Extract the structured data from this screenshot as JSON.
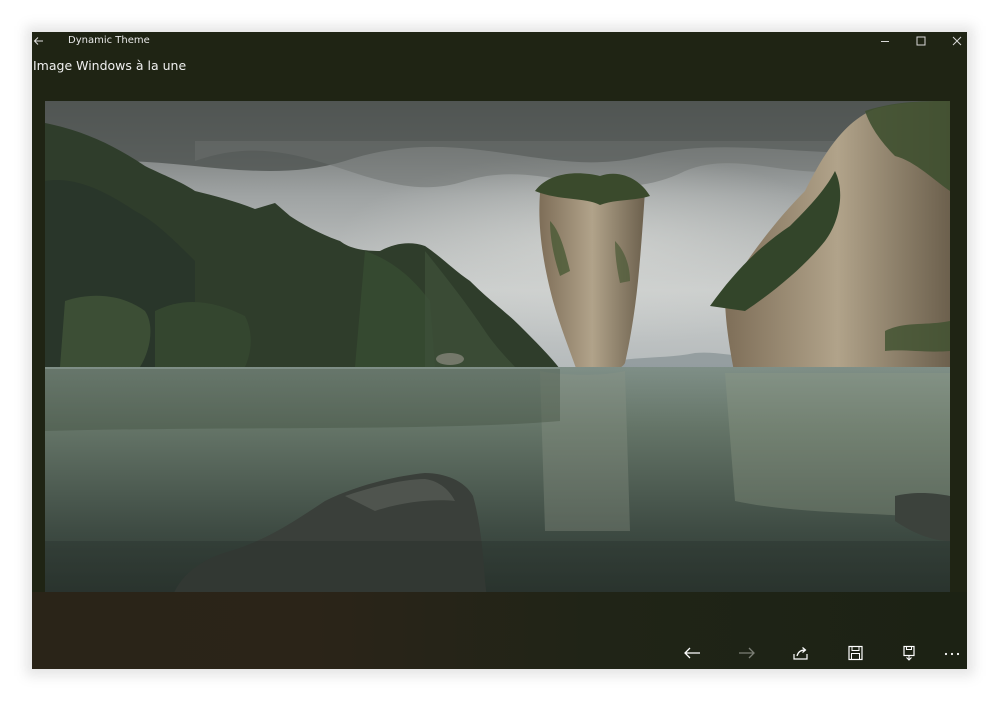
{
  "window": {
    "title": "Dynamic Theme",
    "heading": "Image Windows à la une",
    "background_color": "#1f2414"
  },
  "titlebar": {
    "back_icon": "arrow-left-icon",
    "minimize_icon": "minimize-icon",
    "maximize_icon": "maximize-icon",
    "close_icon": "close-icon"
  },
  "image": {
    "subject": "karst-islands-seascape"
  },
  "commandbar": {
    "items": [
      {
        "icon": "arrow-left-icon",
        "enabled": true
      },
      {
        "icon": "arrow-right-icon",
        "enabled": false
      },
      {
        "icon": "share-icon",
        "enabled": true
      },
      {
        "icon": "save-icon",
        "enabled": true
      },
      {
        "icon": "save-as-icon",
        "enabled": true
      },
      {
        "icon": "more-icon",
        "enabled": true
      }
    ]
  }
}
